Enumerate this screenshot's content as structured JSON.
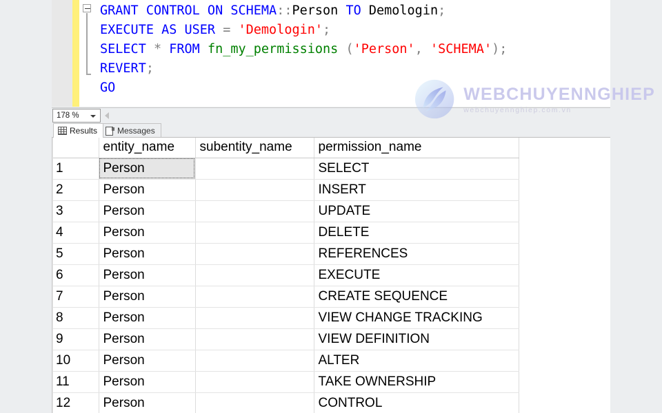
{
  "editor": {
    "fold_state": "expanded",
    "lines": [
      {
        "id": "line-1",
        "tokens": [
          {
            "t": "GRANT CONTROL ON SCHEMA",
            "c": "kw"
          },
          {
            "t": "::",
            "c": "pn"
          },
          {
            "t": "Person ",
            "c": "txt"
          },
          {
            "t": "TO",
            "c": "kw"
          },
          {
            "t": " Demologin",
            "c": "txt"
          },
          {
            "t": ";",
            "c": "pn"
          }
        ]
      },
      {
        "id": "line-2",
        "tokens": [
          {
            "t": "EXECUTE AS USER",
            "c": "kw"
          },
          {
            "t": " ",
            "c": "txt"
          },
          {
            "t": "=",
            "c": "op"
          },
          {
            "t": " ",
            "c": "txt"
          },
          {
            "t": "'Demologin'",
            "c": "str"
          },
          {
            "t": ";",
            "c": "pn"
          }
        ]
      },
      {
        "id": "line-3",
        "tokens": [
          {
            "t": "SELECT",
            "c": "kw"
          },
          {
            "t": " ",
            "c": "txt"
          },
          {
            "t": "*",
            "c": "op"
          },
          {
            "t": " ",
            "c": "txt"
          },
          {
            "t": "FROM",
            "c": "kw"
          },
          {
            "t": " ",
            "c": "txt"
          },
          {
            "t": "fn_my_permissions",
            "c": "fn"
          },
          {
            "t": " (",
            "c": "pn"
          },
          {
            "t": "'Person'",
            "c": "str"
          },
          {
            "t": ", ",
            "c": "pn"
          },
          {
            "t": "'SCHEMA'",
            "c": "str"
          },
          {
            "t": ");",
            "c": "pn"
          }
        ]
      },
      {
        "id": "line-4",
        "tokens": [
          {
            "t": "REVERT",
            "c": "kw"
          },
          {
            "t": ";",
            "c": "pn"
          }
        ]
      },
      {
        "id": "line-5",
        "tokens": [
          {
            "t": "GO",
            "c": "kw"
          }
        ]
      }
    ]
  },
  "zoom_bar": {
    "zoom_level": "178 %",
    "scroll_left_icon": "triangle-left-icon"
  },
  "tabs": [
    {
      "label": "Results",
      "icon": "grid-icon",
      "active": true
    },
    {
      "label": "Messages",
      "icon": "document-icon",
      "active": false
    }
  ],
  "grid": {
    "columns": [
      "",
      "entity_name",
      "subentity_name",
      "permission_name"
    ],
    "selected_cell": {
      "row": 1,
      "column": "entity_name"
    },
    "rows": [
      {
        "num": "1",
        "entity_name": "Person",
        "subentity_name": "",
        "permission_name": "SELECT"
      },
      {
        "num": "2",
        "entity_name": "Person",
        "subentity_name": "",
        "permission_name": "INSERT"
      },
      {
        "num": "3",
        "entity_name": "Person",
        "subentity_name": "",
        "permission_name": "UPDATE"
      },
      {
        "num": "4",
        "entity_name": "Person",
        "subentity_name": "",
        "permission_name": "DELETE"
      },
      {
        "num": "5",
        "entity_name": "Person",
        "subentity_name": "",
        "permission_name": "REFERENCES"
      },
      {
        "num": "6",
        "entity_name": "Person",
        "subentity_name": "",
        "permission_name": "EXECUTE"
      },
      {
        "num": "7",
        "entity_name": "Person",
        "subentity_name": "",
        "permission_name": "CREATE SEQUENCE"
      },
      {
        "num": "8",
        "entity_name": "Person",
        "subentity_name": "",
        "permission_name": "VIEW CHANGE TRACKING"
      },
      {
        "num": "9",
        "entity_name": "Person",
        "subentity_name": "",
        "permission_name": "VIEW DEFINITION"
      },
      {
        "num": "10",
        "entity_name": "Person",
        "subentity_name": "",
        "permission_name": "ALTER"
      },
      {
        "num": "11",
        "entity_name": "Person",
        "subentity_name": "",
        "permission_name": "TAKE OWNERSHIP"
      },
      {
        "num": "12",
        "entity_name": "Person",
        "subentity_name": "",
        "permission_name": "CONTROL"
      }
    ]
  },
  "watermark": {
    "title": "WEBCHUYENNGHIEP",
    "subtitle": "webchuyennghiep.com.vn",
    "logo_icon": "swirl-logo-icon"
  },
  "colors": {
    "keyword": "#0000ff",
    "string": "#ff0000",
    "function": "#008000",
    "operator": "#808080",
    "change_bar": "#fff07a",
    "selection": "#e6e6e6",
    "chrome": "#eceef0",
    "watermark_purple": "#c8c7ec"
  }
}
